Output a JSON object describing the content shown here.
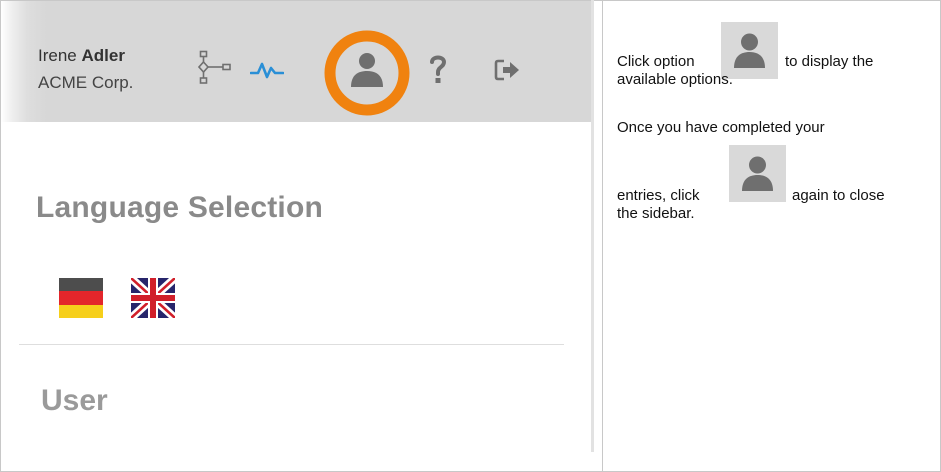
{
  "screenshot": {
    "user_name_first": "Irene ",
    "user_name_last": "Adler",
    "company": "ACME Corp.",
    "toolbar": {
      "icons": [
        "workflow-icon",
        "activity-icon",
        "user-icon",
        "help-icon",
        "logout-icon"
      ],
      "highlighted": "user-icon"
    },
    "language_heading": "Language Selection",
    "languages": [
      "german-flag",
      "uk-flag"
    ],
    "user_heading": "User"
  },
  "instructions": {
    "p1_before": "Click option",
    "p1_after_1": "to display the",
    "p1_after_2": "available options.",
    "p2_line1": "Once you have completed your",
    "p2_before": "entries, click",
    "p2_after": "again to close",
    "p2_line3": "the sidebar."
  },
  "colors": {
    "highlight_ring": "#f0820f",
    "activity_blue": "#2a8fd6",
    "icon_gray": "#6f6f6f",
    "topbar_gray": "#d7d7d7"
  }
}
